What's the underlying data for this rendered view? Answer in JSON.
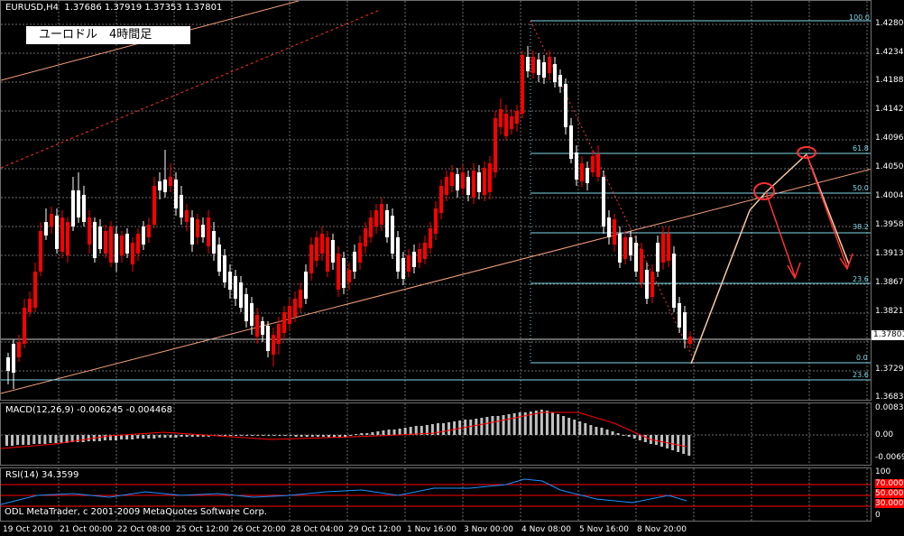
{
  "header": {
    "title": "EURUSD,H4  1.37686 1.37919 1.37353 1.37801",
    "symbol_label": "ユーロドル　4時間足"
  },
  "price_axis": {
    "labels": [
      "1.42800",
      "1.42340",
      "1.41880",
      "1.41420",
      "1.40960",
      "1.40500",
      "1.40040",
      "1.39580",
      "1.39130",
      "1.38670",
      "1.38210",
      "1.37290",
      "1.36830"
    ],
    "current_price": "1.37801"
  },
  "fibonacci": {
    "levels": [
      "100.0",
      "61.8",
      "50.0",
      "38.2",
      "23.6",
      "0.0",
      "23.6"
    ]
  },
  "macd": {
    "title": "MACD(12,26,9) -0.006245 -0.004468",
    "scale": [
      "0.00835",
      "0.00",
      "-0.00694"
    ]
  },
  "rsi": {
    "title": "RSI(14) 34.3599",
    "scale": [
      "100",
      "70.0000",
      "50.0000",
      "30.0000",
      "0"
    ]
  },
  "copyright": "ODL MetaTrader, c 2001-2009 MetaQuotes Software Corp.",
  "time_axis": {
    "labels": [
      "19 Oct 2010",
      "21 Oct 00:00",
      "22 Oct 08:00",
      "25 Oct 12:00",
      "26 Oct 20:00",
      "28 Oct 04:00",
      "29 Oct 12:00",
      "1 Nov 16:00",
      "3 Nov 00:00",
      "4 Nov 08:00",
      "5 Nov 16:00",
      "8 Nov 20:00"
    ]
  },
  "colors": {
    "background": "#000000",
    "grid": "#6e6e6e",
    "bull": "#ffffff",
    "bear": "#ff0000",
    "fib": "#7fd8e8",
    "trend": "#f4a07a",
    "annotation": "#ff3030"
  }
}
